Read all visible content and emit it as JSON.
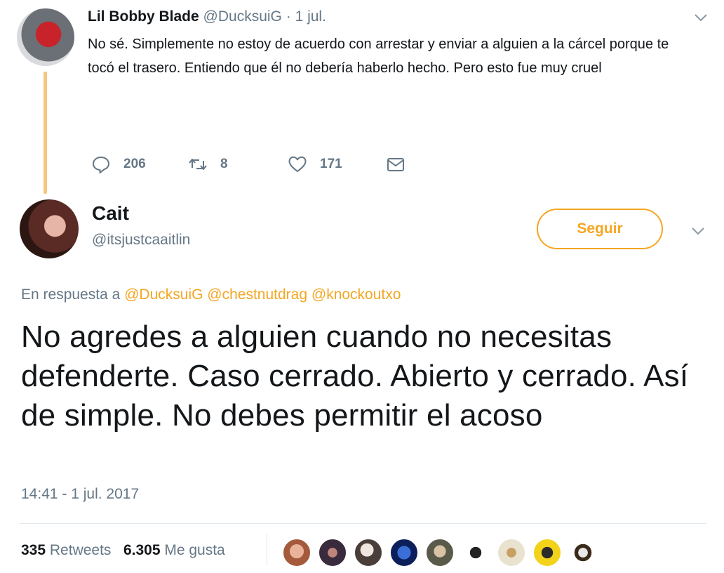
{
  "parent_tweet": {
    "name": "Lil Bobby Blade",
    "handle": "@DucksuiG",
    "separator": "·",
    "date": "1 jul.",
    "text": "No sé. Simplemente no estoy de acuerdo con arrestar y enviar a alguien a la cárcel porque te tocó el trasero. Entiendo que él no debería haberlo hecho. Pero esto fue muy cruel",
    "replies": "206",
    "retweets": "8",
    "likes": "171"
  },
  "main_tweet": {
    "name": "Cait",
    "handle": "@itsjustcaaitlin",
    "follow_label": "Seguir",
    "reply_prefix": "En respuesta a",
    "mentions": [
      "@DucksuiG",
      "@chestnutdrag",
      "@knockoutxo"
    ],
    "text": "No agredes a alguien cuando no necesitas defenderte. Caso cerrado. Abierto y cerrado. Así de simple. No debes permitir el acoso",
    "timestamp": "14:41 - 1 jul. 2017",
    "retweet_count": "335",
    "retweet_label": "Retweets",
    "like_count": "6.305",
    "like_label": "Me gusta"
  },
  "colors": {
    "accent": "#f5a623",
    "thread_line": "#f5c77e",
    "muted": "#657786",
    "text": "#14171a"
  },
  "icons": {
    "reply": "reply-icon",
    "retweet": "retweet-icon",
    "like": "heart-icon",
    "dm": "envelope-icon",
    "more": "chevron-down-icon"
  }
}
